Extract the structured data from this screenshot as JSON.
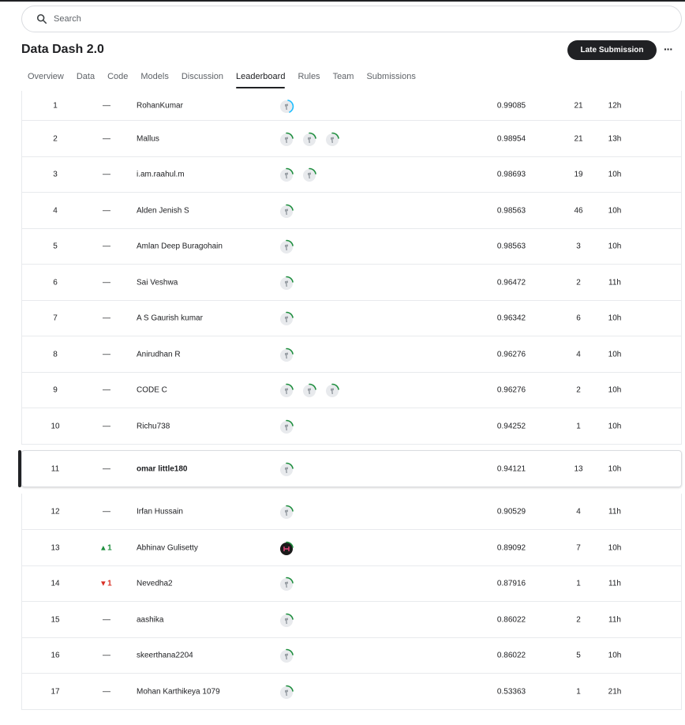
{
  "search": {
    "placeholder": "Search"
  },
  "competition": {
    "title": "Data Dash 2.0"
  },
  "actions": {
    "late_submission_label": "Late Submission",
    "more_label": "···"
  },
  "tabs": [
    {
      "label": "Overview"
    },
    {
      "label": "Data"
    },
    {
      "label": "Code"
    },
    {
      "label": "Models"
    },
    {
      "label": "Discussion"
    },
    {
      "label": "Leaderboard",
      "active": true
    },
    {
      "label": "Rules"
    },
    {
      "label": "Team"
    },
    {
      "label": "Submissions"
    }
  ],
  "leaderboard": {
    "rows": [
      {
        "rank": "1",
        "change": "—",
        "team": "RohanKumar",
        "members": 1,
        "score": "0.99085",
        "entries": "21",
        "last": "12h"
      },
      {
        "rank": "2",
        "change": "—",
        "team": "Mallus",
        "members": 3,
        "score": "0.98954",
        "entries": "21",
        "last": "13h"
      },
      {
        "rank": "3",
        "change": "—",
        "team": "i.am.raahul.m",
        "members": 2,
        "score": "0.98693",
        "entries": "19",
        "last": "10h"
      },
      {
        "rank": "4",
        "change": "—",
        "team": "Alden Jenish S",
        "members": 1,
        "score": "0.98563",
        "entries": "46",
        "last": "10h"
      },
      {
        "rank": "5",
        "change": "—",
        "team": "Amlan Deep Buragohain",
        "members": 1,
        "score": "0.98563",
        "entries": "3",
        "last": "10h"
      },
      {
        "rank": "6",
        "change": "—",
        "team": "Sai Veshwa",
        "members": 1,
        "score": "0.96472",
        "entries": "2",
        "last": "11h"
      },
      {
        "rank": "7",
        "change": "—",
        "team": "A S Gaurish kumar",
        "members": 1,
        "score": "0.96342",
        "entries": "6",
        "last": "10h"
      },
      {
        "rank": "8",
        "change": "—",
        "team": "Anirudhan R",
        "members": 1,
        "score": "0.96276",
        "entries": "4",
        "last": "10h"
      },
      {
        "rank": "9",
        "change": "—",
        "team": "CODE C",
        "members": 3,
        "score": "0.96276",
        "entries": "2",
        "last": "10h"
      },
      {
        "rank": "10",
        "change": "—",
        "team": "Richu738",
        "members": 1,
        "score": "0.94252",
        "entries": "1",
        "last": "10h"
      },
      {
        "rank": "11",
        "change": "—",
        "team": "omar little180",
        "members": 1,
        "score": "0.94121",
        "entries": "13",
        "last": "10h",
        "is_me": true
      },
      {
        "rank": "12",
        "change": "—",
        "team": "Irfan Hussain",
        "members": 1,
        "score": "0.90529",
        "entries": "4",
        "last": "11h"
      },
      {
        "rank": "13",
        "change": "▴ 1",
        "change_dir": "up",
        "team": "Abhinav Gulisetty",
        "members": 1,
        "dark_avatar": true,
        "score": "0.89092",
        "entries": "7",
        "last": "10h"
      },
      {
        "rank": "14",
        "change": "▾ 1",
        "change_dir": "down",
        "team": "Nevedha2",
        "members": 1,
        "score": "0.87916",
        "entries": "1",
        "last": "11h"
      },
      {
        "rank": "15",
        "change": "—",
        "team": "aashika",
        "members": 1,
        "score": "0.86022",
        "entries": "2",
        "last": "11h"
      },
      {
        "rank": "16",
        "change": "—",
        "team": "skeerthana2204",
        "members": 1,
        "score": "0.86022",
        "entries": "5",
        "last": "10h"
      },
      {
        "rank": "17",
        "change": "—",
        "team": "Mohan Karthikeya 1079",
        "members": 1,
        "score": "0.53363",
        "entries": "1",
        "last": "21h"
      }
    ]
  },
  "colors": {
    "accent": "#202124",
    "progress_ring": "#20beff",
    "tier_ring": "#1e8e3e",
    "up": "#1e8e3e",
    "down": "#d93025"
  }
}
